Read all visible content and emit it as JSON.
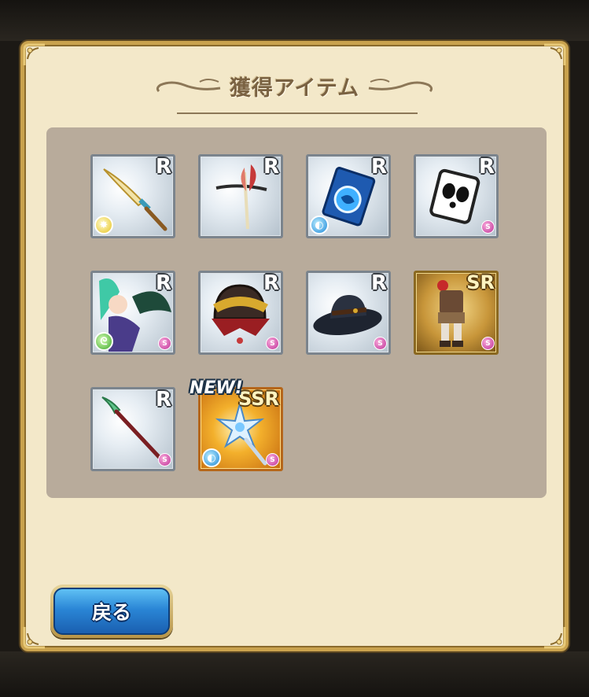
{
  "dialog": {
    "title": "獲得アイテム"
  },
  "items": [
    {
      "rarity": "R",
      "icon": "golden-sword-icon",
      "element": "light",
      "element_glyph": "✸",
      "skill_badge": ""
    },
    {
      "rarity": "R",
      "icon": "feathered-pick-icon",
      "element": "",
      "element_glyph": "",
      "skill_badge": ""
    },
    {
      "rarity": "R",
      "icon": "blue-tome-icon",
      "element": "water",
      "element_glyph": "◐",
      "skill_badge": ""
    },
    {
      "rarity": "R",
      "icon": "panda-mask-icon",
      "element": "",
      "element_glyph": "",
      "skill_badge": "S"
    },
    {
      "rarity": "R",
      "icon": "winged-girl-icon",
      "element": "wind",
      "element_glyph": "ᘓ",
      "skill_badge": "S"
    },
    {
      "rarity": "R",
      "icon": "samurai-helmet-icon",
      "element": "",
      "element_glyph": "",
      "skill_badge": "S"
    },
    {
      "rarity": "R",
      "icon": "black-hat-icon",
      "element": "",
      "element_glyph": "",
      "skill_badge": "S"
    },
    {
      "rarity": "SR",
      "icon": "costume-outfit-icon",
      "element": "",
      "element_glyph": "",
      "skill_badge": "S"
    },
    {
      "rarity": "R",
      "icon": "green-spear-icon",
      "element": "",
      "element_glyph": "",
      "skill_badge": "S"
    },
    {
      "rarity": "SSR",
      "icon": "crystal-staff-icon",
      "element": "water",
      "element_glyph": "◐",
      "skill_badge": "S",
      "new_label": "NEW!"
    }
  ],
  "back_button": {
    "label": "戻る"
  },
  "colors": {
    "panel": "#b8ab9b",
    "dialog_bg": "#f3e8c9",
    "button_blue": "#2a86d6"
  }
}
